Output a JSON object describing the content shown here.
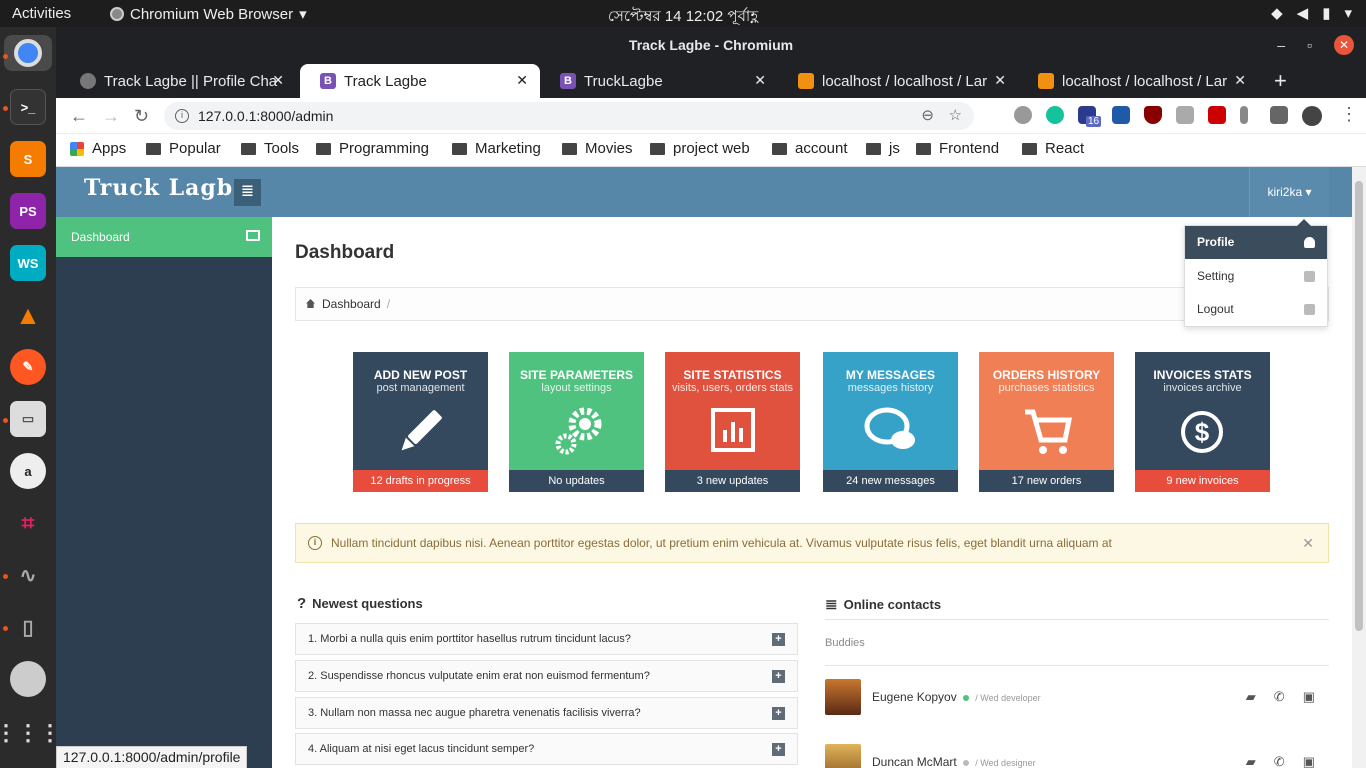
{
  "system": {
    "activities": "Activities",
    "app_name": "Chromium Web Browser",
    "clock": "সেপ্টেম্বর 14  12:02 পূর্বাহ্ণ"
  },
  "window": {
    "title": "Track Lagbe - Chromium"
  },
  "tabs": [
    {
      "label": "Track Lagbe || Profile Cha"
    },
    {
      "label": "Track Lagbe"
    },
    {
      "label": "TruckLagbe"
    },
    {
      "label": "localhost / localhost / Lar"
    },
    {
      "label": "localhost / localhost / Lar"
    }
  ],
  "address_bar": {
    "url": "127.0.0.1:8000/admin"
  },
  "bookmarks": [
    "Apps",
    "Popular",
    "Tools",
    "Programming",
    "Marketing",
    "Movies",
    "project web",
    "account",
    "js",
    "Frontend",
    "React"
  ],
  "extension_badge": "16",
  "app": {
    "logo": "Truck Lagbe",
    "user": "kiri2ka",
    "sidebar": {
      "dashboard": "Dashboard"
    },
    "page_title": "Dashboard",
    "breadcrumb": {
      "item": "Dashboard",
      "sep": "/"
    },
    "tiles": [
      {
        "title": "ADD NEW POST",
        "subtitle": "post management",
        "footer": "12 drafts in progress",
        "icon": "pencil-icon",
        "color": "#34495e",
        "footer_color": "#e74c3c"
      },
      {
        "title": "SITE PARAMETERS",
        "subtitle": "layout settings",
        "footer": "No updates",
        "icon": "gears-icon",
        "color": "#4ec27e",
        "footer_color": "#34495e"
      },
      {
        "title": "SITE STATISTICS",
        "subtitle": "visits, users, orders stats",
        "footer": "3 new updates",
        "icon": "chart-icon",
        "color": "#e0523e",
        "footer_color": "#34495e"
      },
      {
        "title": "MY MESSAGES",
        "subtitle": "messages history",
        "footer": "24 new messages",
        "icon": "chat-icon",
        "color": "#36a2c8",
        "footer_color": "#34495e"
      },
      {
        "title": "ORDERS HISTORY",
        "subtitle": "purchases statistics",
        "footer": "17 new orders",
        "icon": "cart-icon",
        "color": "#f07f55",
        "footer_color": "#34495e"
      },
      {
        "title": "INVOICES STATS",
        "subtitle": "invoices archive",
        "footer": "9 new invoices",
        "icon": "dollar-icon",
        "color": "#34495e",
        "footer_color": "#e74c3c"
      }
    ],
    "alert": "Nullam tincidunt dapibus nisi. Aenean porttitor egestas dolor, ut pretium enim vehicula at. Vivamus vulputate risus felis, eget blandit urna aliquam at",
    "questions": {
      "heading": "Newest questions",
      "items": [
        "1. Morbi a nulla quis enim porttitor hasellus rutrum tincidunt lacus?",
        "2. Suspendisse rhoncus vulputate enim erat non euismod fermentum?",
        "3. Nullam non massa nec augue pharetra venenatis facilisis viverra?",
        "4. Aliquam at nisi eget lacus tincidunt semper?"
      ]
    },
    "contacts": {
      "heading": "Online contacts",
      "group": "Buddies",
      "items": [
        {
          "name": "Eugene Kopyov",
          "role": "Wed developer",
          "status_color": "#4ec27e"
        },
        {
          "name": "Duncan McMart",
          "role": "Wed designer",
          "status_color": "#bbbbbb"
        }
      ]
    },
    "dropdown": [
      {
        "label": "Profile"
      },
      {
        "label": "Setting"
      },
      {
        "label": "Logout"
      }
    ]
  },
  "status_url": "127.0.0.1:8000/admin/profile"
}
